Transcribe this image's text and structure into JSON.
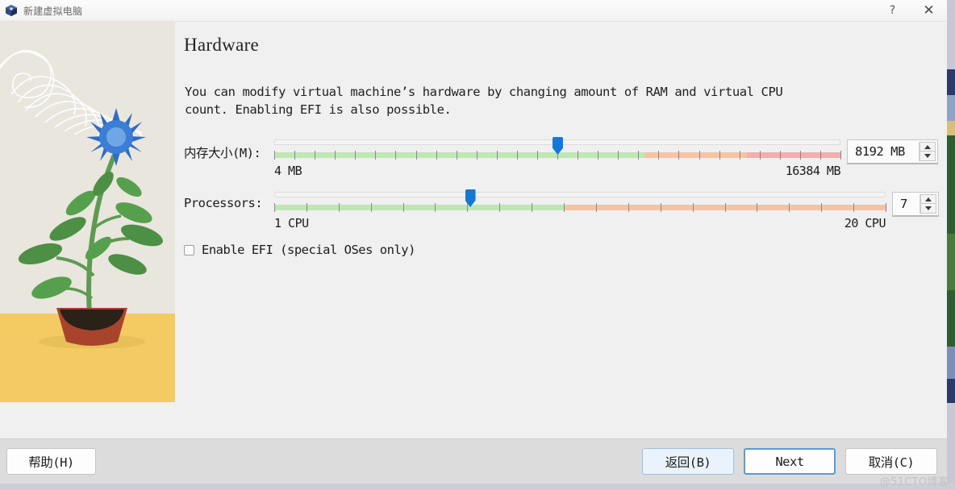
{
  "window": {
    "title": "新建虚拟电脑",
    "icon": "virtualbox-cube-icon",
    "help_button": "?",
    "close_button": "✕"
  },
  "page": {
    "heading": "Hardware",
    "description": "You can modify virtual machine’s hardware by changing amount of RAM and virtual CPU count. Enabling EFI is also possible."
  },
  "memory": {
    "label": "内存大小(M):",
    "min_label": "4 MB",
    "max_label": "16384 MB",
    "value": "8192 MB",
    "value_number": 8192,
    "min": 4,
    "max": 16384,
    "handle_percent": 50,
    "green_end_percent": 65.5,
    "orange_end_percent": 83.5,
    "spin_up": "▲",
    "spin_down": "▼"
  },
  "processors": {
    "label": "Processors:",
    "min_label": "1 CPU",
    "max_label": "20 CPU",
    "value": "7",
    "value_number": 7,
    "min": 1,
    "max": 20,
    "handle_percent": 32,
    "green_end_percent": 47.5,
    "spin_up": "▲",
    "spin_down": "▼"
  },
  "efi": {
    "label": "Enable EFI (special OSes only)",
    "checked": false
  },
  "footer": {
    "help": "帮助(H)",
    "back": "返回(B)",
    "next": "Next",
    "cancel": "取消(C)"
  },
  "watermark": "@51CTO博客",
  "colors": {
    "accent": "#1479d4",
    "slider_green": "#bfe6b4",
    "slider_orange": "#f4c3a4",
    "slider_red": "#f3aeae",
    "sidebar_bg": "#e9e6de",
    "sidebar_ground": "#f3cb62",
    "footer_bg": "#dcdcdc",
    "focus_border": "#5b9bd5"
  }
}
